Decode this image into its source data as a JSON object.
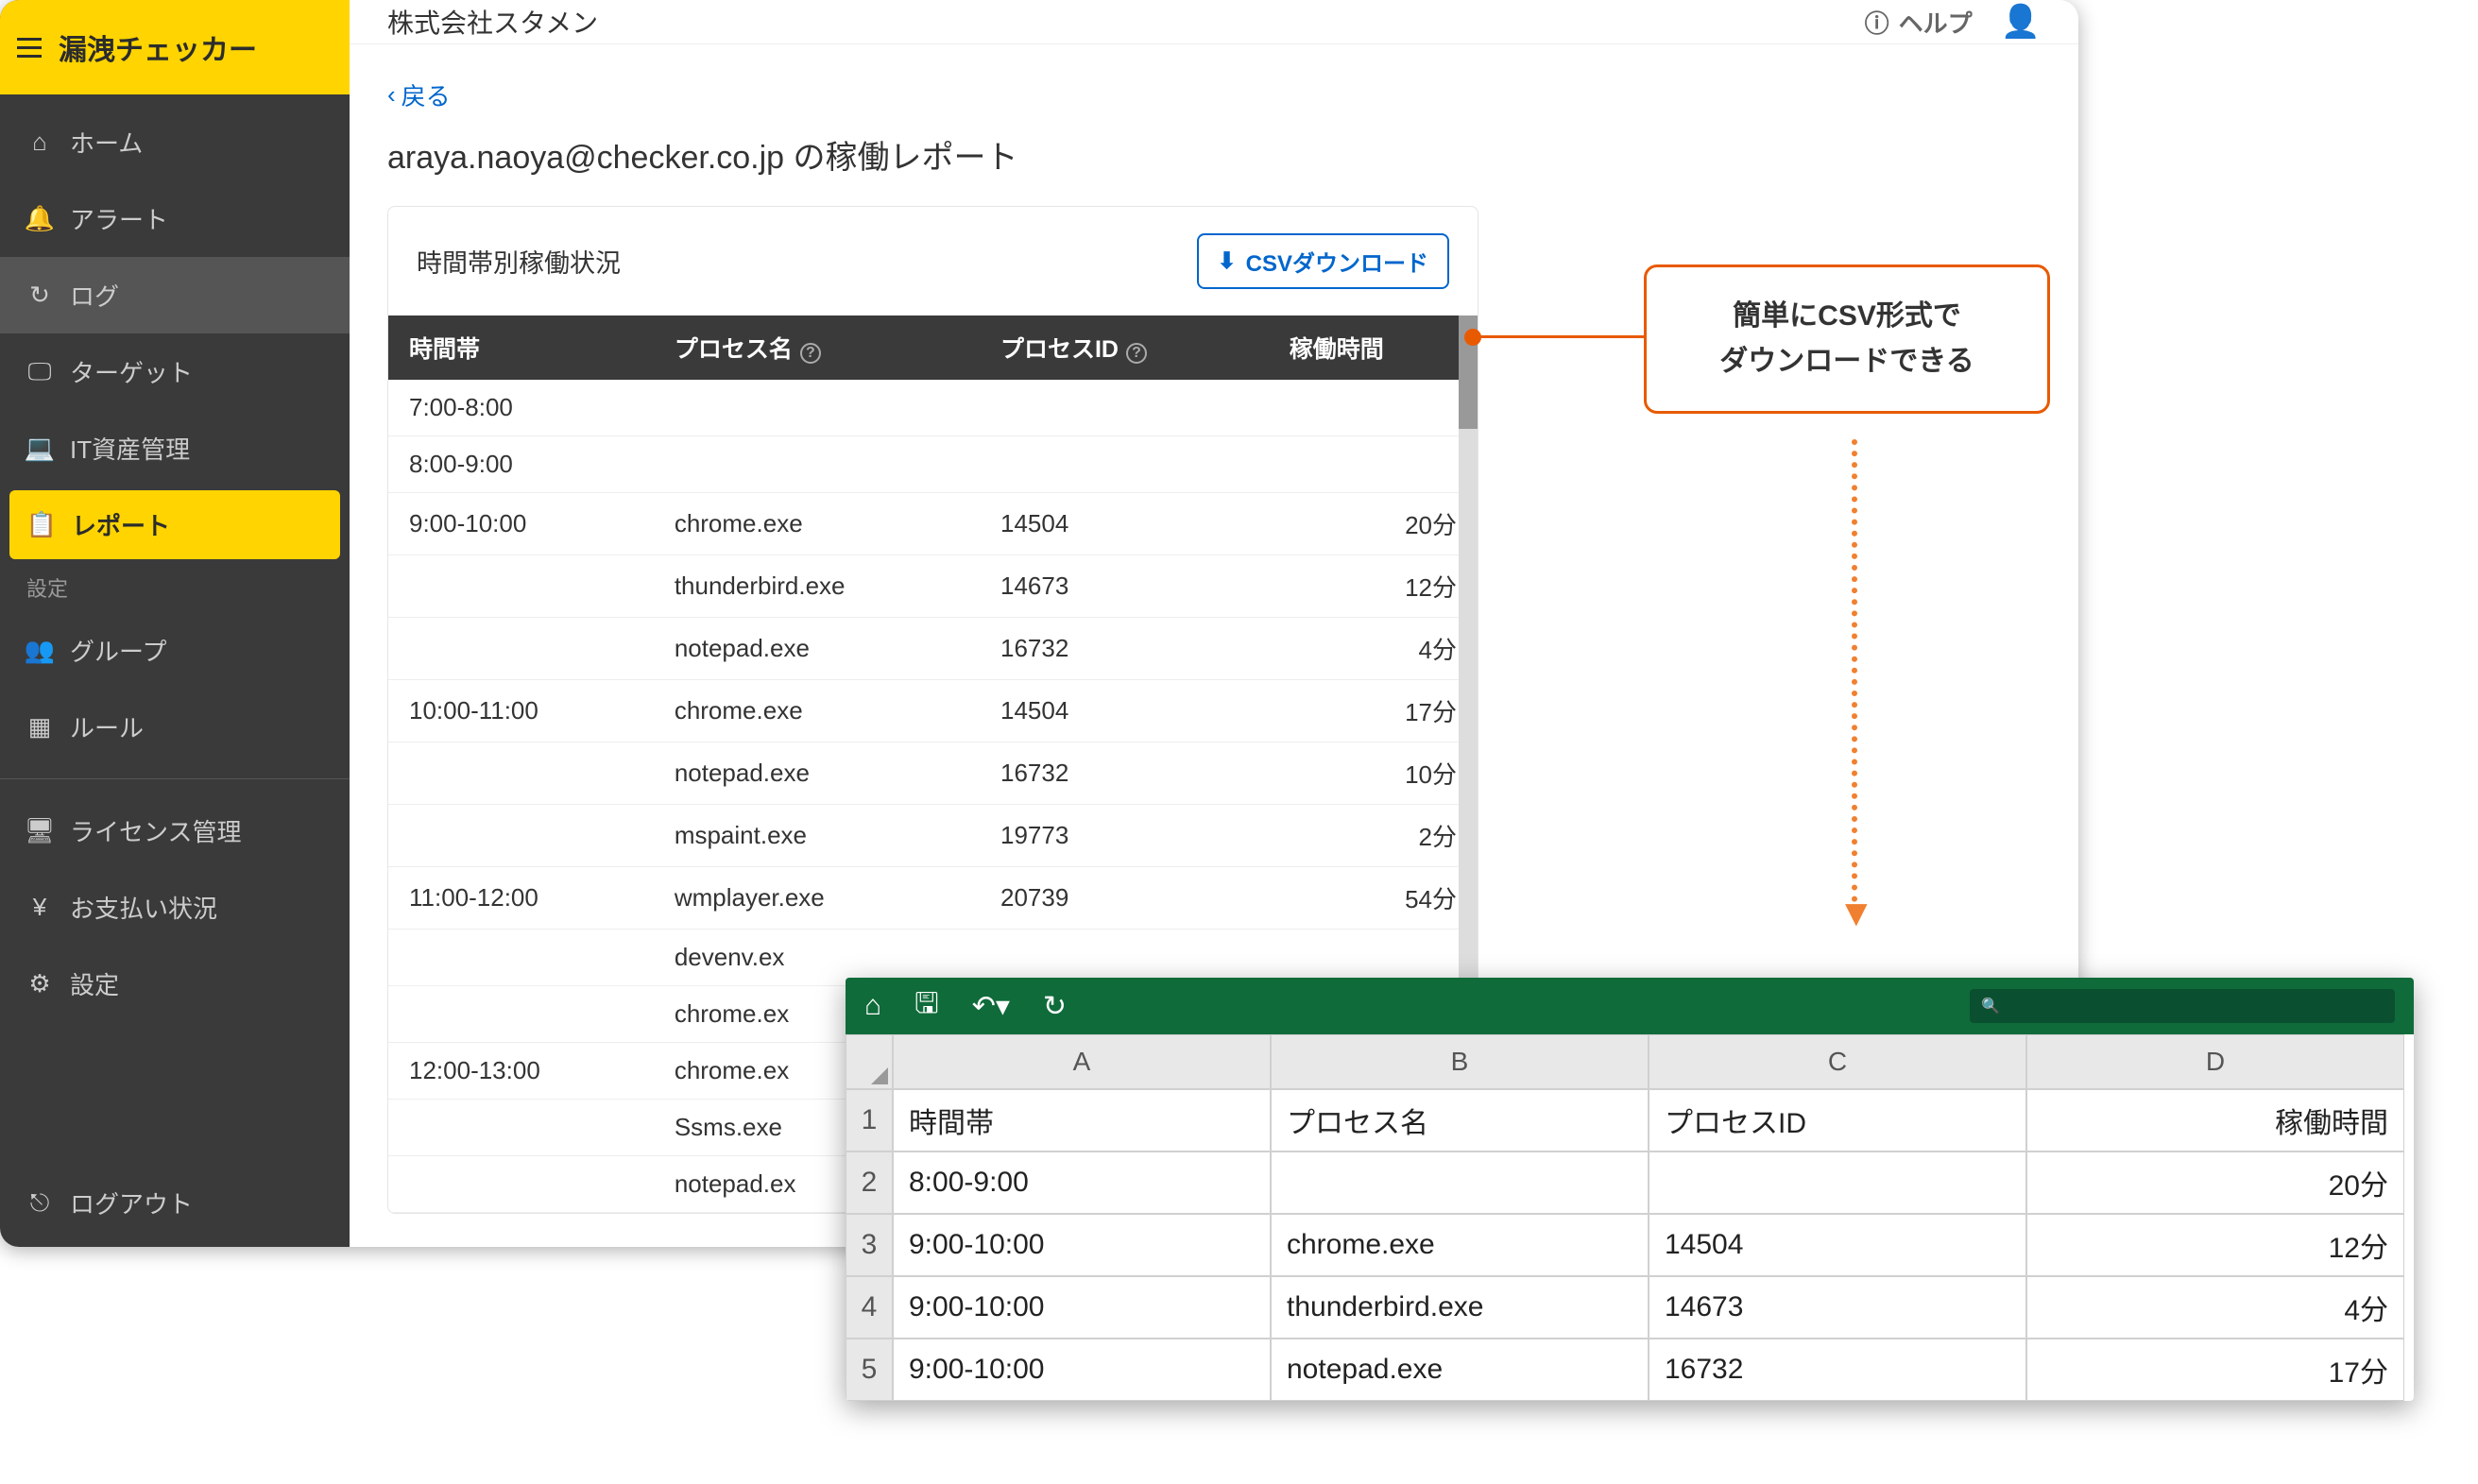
{
  "brand": "漏洩チェッカー",
  "company": "株式会社スタメン",
  "help_label": "ヘルプ",
  "sidebar": {
    "items": [
      {
        "icon": "home",
        "label": "ホーム"
      },
      {
        "icon": "bell",
        "label": "アラート"
      },
      {
        "icon": "history",
        "label": "ログ",
        "active_dark": true
      },
      {
        "icon": "monitor",
        "label": "ターゲット"
      },
      {
        "icon": "laptop",
        "label": "IT資産管理"
      },
      {
        "icon": "clipboard",
        "label": "レポート",
        "active_yellow": true
      }
    ],
    "section_label": "設定",
    "settings_items": [
      {
        "icon": "group",
        "label": "グループ"
      },
      {
        "icon": "grid",
        "label": "ルール"
      }
    ],
    "bottom_items": [
      {
        "icon": "display",
        "label": "ライセンス管理"
      },
      {
        "icon": "yen",
        "label": "お支払い状況"
      },
      {
        "icon": "gear",
        "label": "設定"
      }
    ],
    "logout": "ログアウト"
  },
  "back": "戻る",
  "page_title": "araya.naoya@checker.co.jp の稼働レポート",
  "card_title": "時間帯別稼働状況",
  "csv_button": "CSVダウンロード",
  "columns": {
    "time": "時間帯",
    "process": "プロセス名",
    "pid": "プロセスID",
    "duration": "稼働時間"
  },
  "rows": [
    {
      "time": "7:00-8:00",
      "process": "",
      "pid": "",
      "duration": ""
    },
    {
      "time": "8:00-9:00",
      "process": "",
      "pid": "",
      "duration": ""
    },
    {
      "time": "9:00-10:00",
      "process": "chrome.exe",
      "pid": "14504",
      "duration": "20分"
    },
    {
      "time": "",
      "process": "thunderbird.exe",
      "pid": "14673",
      "duration": "12分"
    },
    {
      "time": "",
      "process": "notepad.exe",
      "pid": "16732",
      "duration": "4分"
    },
    {
      "time": "10:00-11:00",
      "process": "chrome.exe",
      "pid": "14504",
      "duration": "17分"
    },
    {
      "time": "",
      "process": "notepad.exe",
      "pid": "16732",
      "duration": "10分"
    },
    {
      "time": "",
      "process": "mspaint.exe",
      "pid": "19773",
      "duration": "2分"
    },
    {
      "time": "11:00-12:00",
      "process": "wmplayer.exe",
      "pid": "20739",
      "duration": "54分"
    },
    {
      "time": "",
      "process": "devenv.ex",
      "pid": "",
      "duration": ""
    },
    {
      "time": "",
      "process": "chrome.ex",
      "pid": "",
      "duration": ""
    },
    {
      "time": "12:00-13:00",
      "process": "chrome.ex",
      "pid": "",
      "duration": ""
    },
    {
      "time": "",
      "process": "Ssms.exe",
      "pid": "",
      "duration": ""
    },
    {
      "time": "",
      "process": "notepad.ex",
      "pid": "",
      "duration": ""
    }
  ],
  "callout": {
    "line1": "簡単にCSV形式で",
    "line2": "ダウンロードできる"
  },
  "excel": {
    "cols": [
      "A",
      "B",
      "C",
      "D"
    ],
    "rows": [
      {
        "n": "1",
        "a": "時間帯",
        "b": "プロセス名",
        "c": "プロセスID",
        "d": "稼働時間"
      },
      {
        "n": "2",
        "a": "8:00-9:00",
        "b": "",
        "c": "",
        "d": "20分"
      },
      {
        "n": "3",
        "a": "9:00-10:00",
        "b": "chrome.exe",
        "c": "14504",
        "d": "12分"
      },
      {
        "n": "4",
        "a": "9:00-10:00",
        "b": "thunderbird.exe",
        "c": "14673",
        "d": "4分"
      },
      {
        "n": "5",
        "a": "9:00-10:00",
        "b": "notepad.exe",
        "c": "16732",
        "d": "17分"
      }
    ]
  }
}
